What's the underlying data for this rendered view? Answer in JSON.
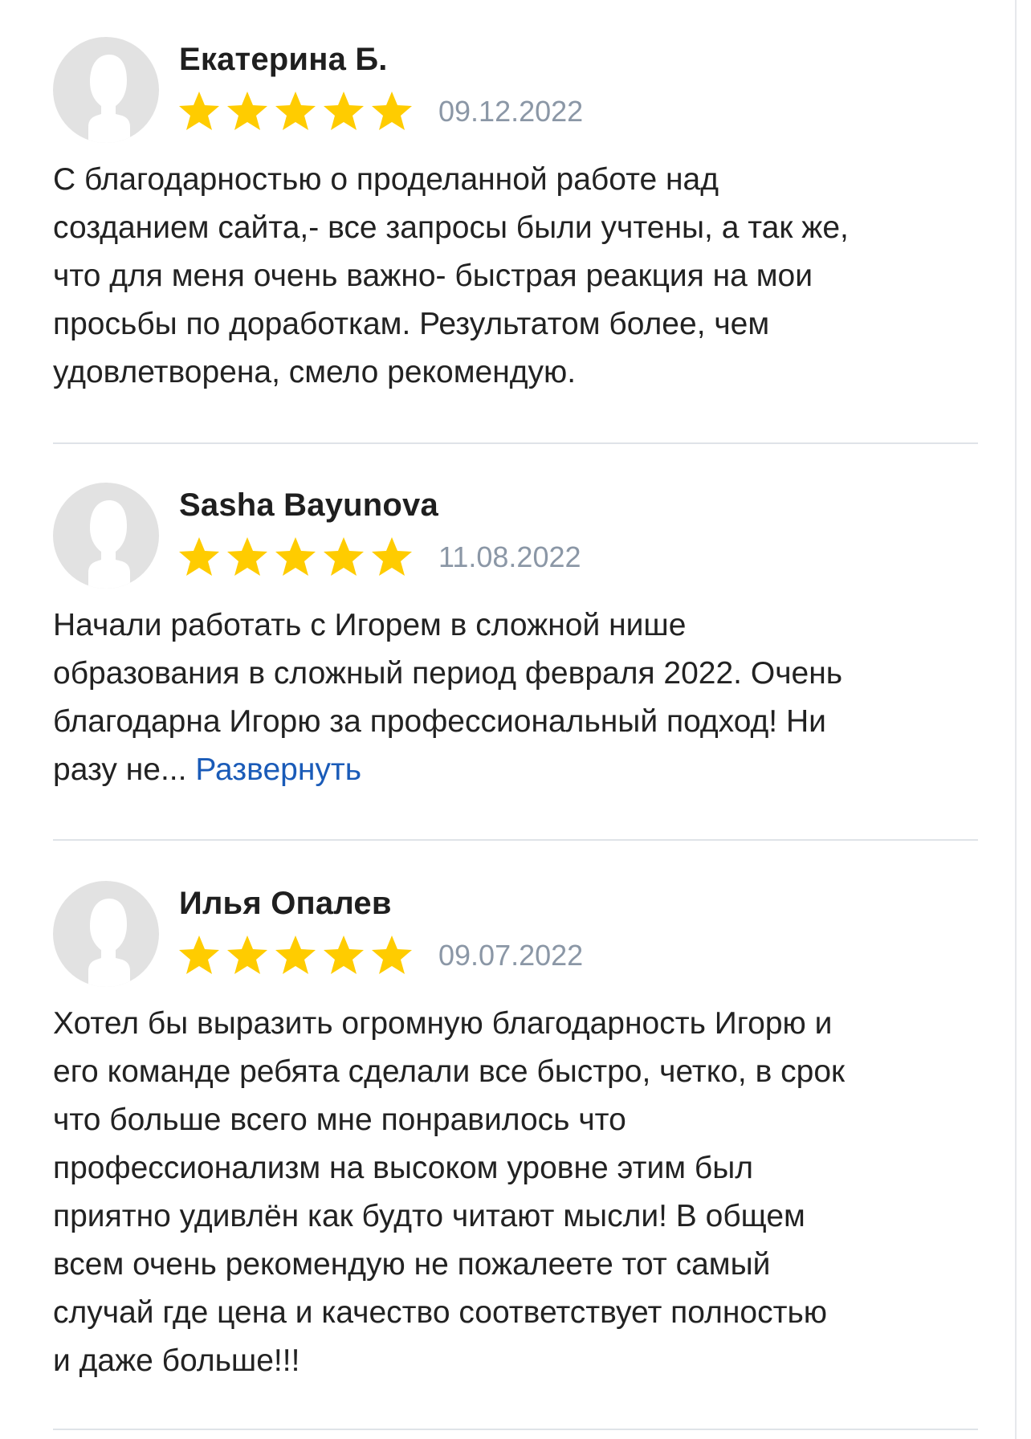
{
  "colors": {
    "star": "#FFCC00",
    "date": "#8B97A6",
    "link": "#1A5BB8",
    "avatar_bg": "#E2E2E2",
    "avatar_fg": "#FFFFFF"
  },
  "reviews": [
    {
      "author": "Екатерина Б.",
      "rating": 5,
      "date": "09.12.2022",
      "lines": [
        "С благодарностью о проделанной работе над",
        "созданием сайта,- все запросы были учтены, а так же,",
        "что для меня очень важно- быстрая реакция на мои",
        "просьбы по доработкам. Результатом более, чем",
        "удовлетворена, смело рекомендую."
      ]
    },
    {
      "author": "Sasha Bayunova",
      "rating": 5,
      "date": "11.08.2022",
      "lines": [
        "Начали работать с Игорем в сложной нише",
        "образования в сложный период февраля 2022. Очень",
        "благодарна Игорю за профессиональный подход! Ни"
      ],
      "truncated_tail": "разу не...",
      "expand_label": "Развернуть"
    },
    {
      "author": "Илья Опалев",
      "rating": 5,
      "date": "09.07.2022",
      "lines": [
        "Хотел бы выразить огромную благодарность Игорю и",
        "его команде ребята сделали все быстро, четко, в срок",
        "что больше всего мне понравилось что",
        "профессионализм на высоком уровне этим был",
        "приятно удивлён как будто читают мысли! В общем",
        "всем очень рекомендую не пожалеете тот самый",
        "случай где цена и качество соответствует полностью",
        "и даже больше!!!"
      ]
    }
  ]
}
